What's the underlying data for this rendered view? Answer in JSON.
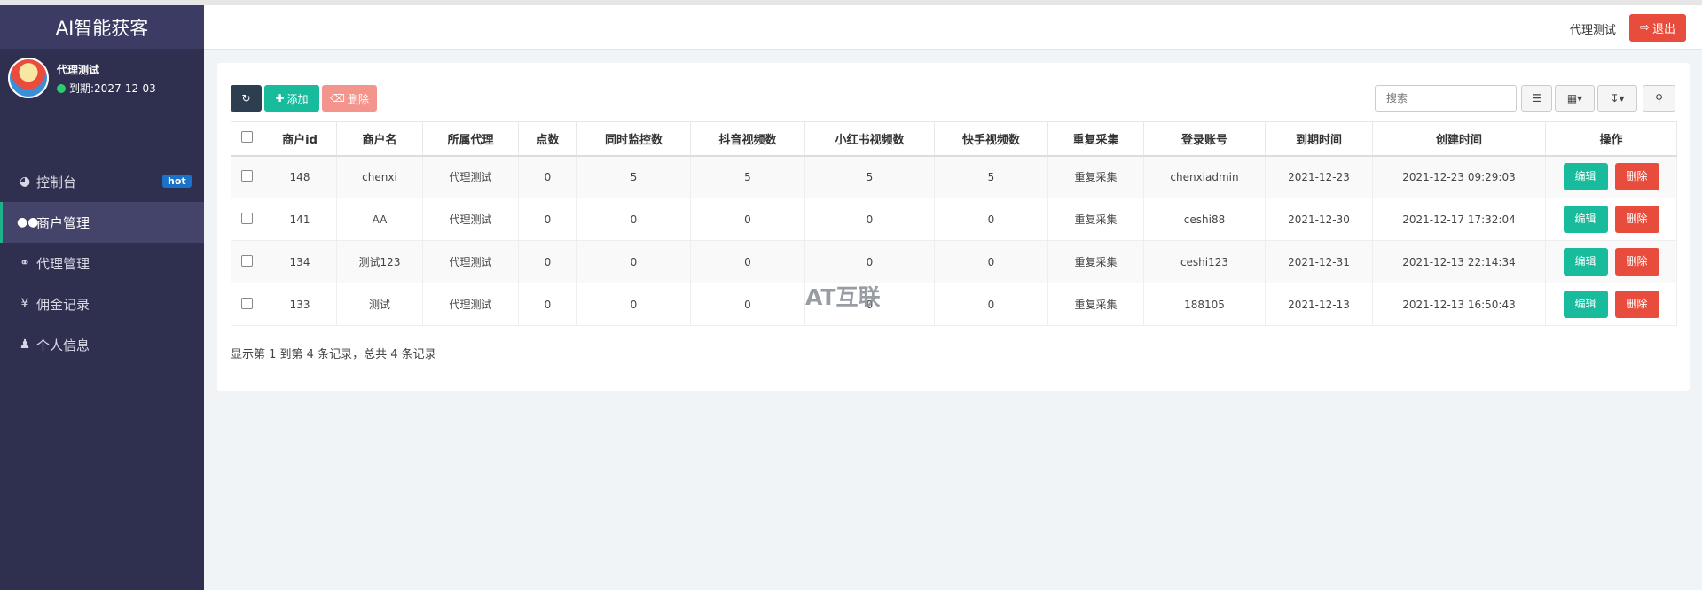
{
  "sidebar": {
    "logo": "AI智能获客",
    "user_name": "代理测试",
    "user_expiry": "到期:2027-12-03",
    "items": [
      {
        "label": "控制台",
        "icon": "dashboard-icon",
        "badge": "hot"
      },
      {
        "label": "商户管理",
        "icon": "users-icon",
        "active": true
      },
      {
        "label": "代理管理",
        "icon": "handshake-icon"
      },
      {
        "label": "佣金记录",
        "icon": "yen-icon"
      },
      {
        "label": "个人信息",
        "icon": "user-icon"
      }
    ]
  },
  "header": {
    "user": "代理测试",
    "logout_label": "退出"
  },
  "toolbar": {
    "refresh_icon": "refresh-icon",
    "add_label": "添加",
    "delete_label": "删除",
    "search_placeholder": "搜索"
  },
  "table": {
    "columns": [
      "商户id",
      "商户名",
      "所属代理",
      "点数",
      "同时监控数",
      "抖音视频数",
      "小红书视频数",
      "快手视频数",
      "重复采集",
      "登录账号",
      "到期时间",
      "创建时间",
      "操作"
    ],
    "rows": [
      [
        "148",
        "chenxi",
        "代理测试",
        "0",
        "5",
        "5",
        "5",
        "5",
        "重复采集",
        "chenxiadmin",
        "2021-12-23",
        "2021-12-23 09:29:03"
      ],
      [
        "141",
        "AA",
        "代理测试",
        "0",
        "0",
        "0",
        "0",
        "0",
        "重复采集",
        "ceshi88",
        "2021-12-30",
        "2021-12-17 17:32:04"
      ],
      [
        "134",
        "测试123",
        "代理测试",
        "0",
        "0",
        "0",
        "0",
        "0",
        "重复采集",
        "ceshi123",
        "2021-12-31",
        "2021-12-13 22:14:34"
      ],
      [
        "133",
        "测试",
        "代理测试",
        "0",
        "0",
        "0",
        "0",
        "0",
        "重复采集",
        "188105",
        "2021-12-13",
        "2021-12-13 16:50:43"
      ]
    ],
    "edit_label": "编辑",
    "delete_label": "删除"
  },
  "pagination": {
    "info": "显示第 1 到第 4 条记录，总共 4 条记录"
  },
  "watermark": "AT互联",
  "colors": {
    "sidebar_bg": "#2f2f4f",
    "primary_green": "#18bc9c",
    "danger_red": "#e74c3c",
    "hot_badge": "#1a73c9"
  }
}
